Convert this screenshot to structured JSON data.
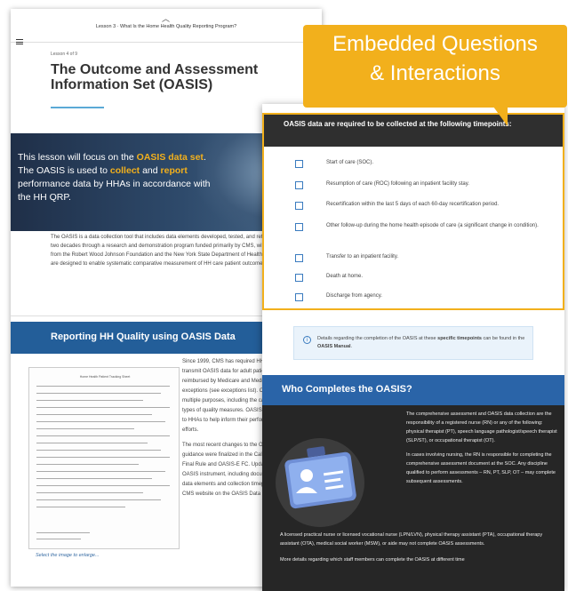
{
  "back": {
    "lesson_header": "Lesson 3 · What Is the Home Health Quality Reporting Program?",
    "lesson_number": "Lesson 4 of 9",
    "title": "The Outcome and Assessment Information Set (OASIS)",
    "hero": {
      "pre": "This lesson will focus on the ",
      "h1": "OASIS data set",
      "mid1": ". The OASIS is used to ",
      "h2": "collect",
      "mid2": " and ",
      "h3": "report",
      "post": " performance data by HHAs in accordance with the HH QRP."
    },
    "intro": "The OASIS is a data collection tool that includes data elements developed, tested, and refined over the course of two decades through a research and demonstration program funded primarily by CMS, with additional funding from the Robert Wood Johnson Foundation and the New York State Department of Health. OASIS data elements are designed to enable systematic comparative measurement of HH care patient outcomes at two points in time.",
    "section_title": "Reporting HH Quality using OASIS Data",
    "form_header": "Home Health Patient Tracking Sheet",
    "enlarge": "Select the image to enlarge...",
    "side_text_1": "Since 1999, CMS has required HHAs to collect and transmit OASIS data for adult patients whose care is reimbursed by Medicare and Medicaid, with some exceptions (see exceptions list). OASIS data are used for multiple purposes, including the calculation of several types of quality measures. OASIS data are also provided to HHAs to help inform their performance improvement efforts.",
    "side_text_2": "The most recent changes to the OASIS instrument and guidance were finalized in the Calendar Year 2020 HH Final Rule and OASIS-E FC. Updates regarding the OASIS instrument, including documents containing the data elements and collection timepoints, are found on the CMS website on the OASIS Data Sets page."
  },
  "callout": {
    "line1": "Embedded Questions",
    "line2": "& Interactions"
  },
  "question": {
    "header": "OASIS data are required to be collected at the following timepoints:",
    "options": [
      "Start of care (SOC).",
      "Resumption of care (ROC) following an inpatient facility stay.",
      "Recertification within the last 5 days of each 60-day recertification period.",
      "Other follow-up during the home health episode of care (a significant change in condition).",
      "Transfer to an inpatient facility.",
      "Death at home.",
      "Discharge from agency."
    ]
  },
  "info": {
    "pre": "Details regarding the completion of the OASIS at these ",
    "b1": "specific timepoints",
    "mid": " can be found in the ",
    "b2": "OASIS Manual",
    "post": "."
  },
  "who": {
    "title": "Who Completes the OASIS?",
    "p1": "The comprehensive assessment and OASIS data collection are the responsibility of a registered nurse (RN) or any of the following: physical therapist (PT), speech language pathologist/speech therapist (SLP/ST), or occupational therapist (OT).",
    "p2": "In cases involving nursing, the RN is responsible for completing the comprehensive assessment document at the SOC. Any discipline qualified to perform assessments – RN, PT, SLP, OT – may complete subsequent assessments.",
    "p3": "A licensed practical nurse or licensed vocational nurse (LPN/LVN), physical therapy assistant (PTA), occupational therapy assistant (OTA), medical social worker (MSW), or aide may not complete OASIS assessments.",
    "p4": "More details regarding which staff members can complete the OASIS at different time"
  },
  "colors": {
    "accent": "#f2b01c",
    "blue": "#235e99",
    "dark": "#262626"
  }
}
